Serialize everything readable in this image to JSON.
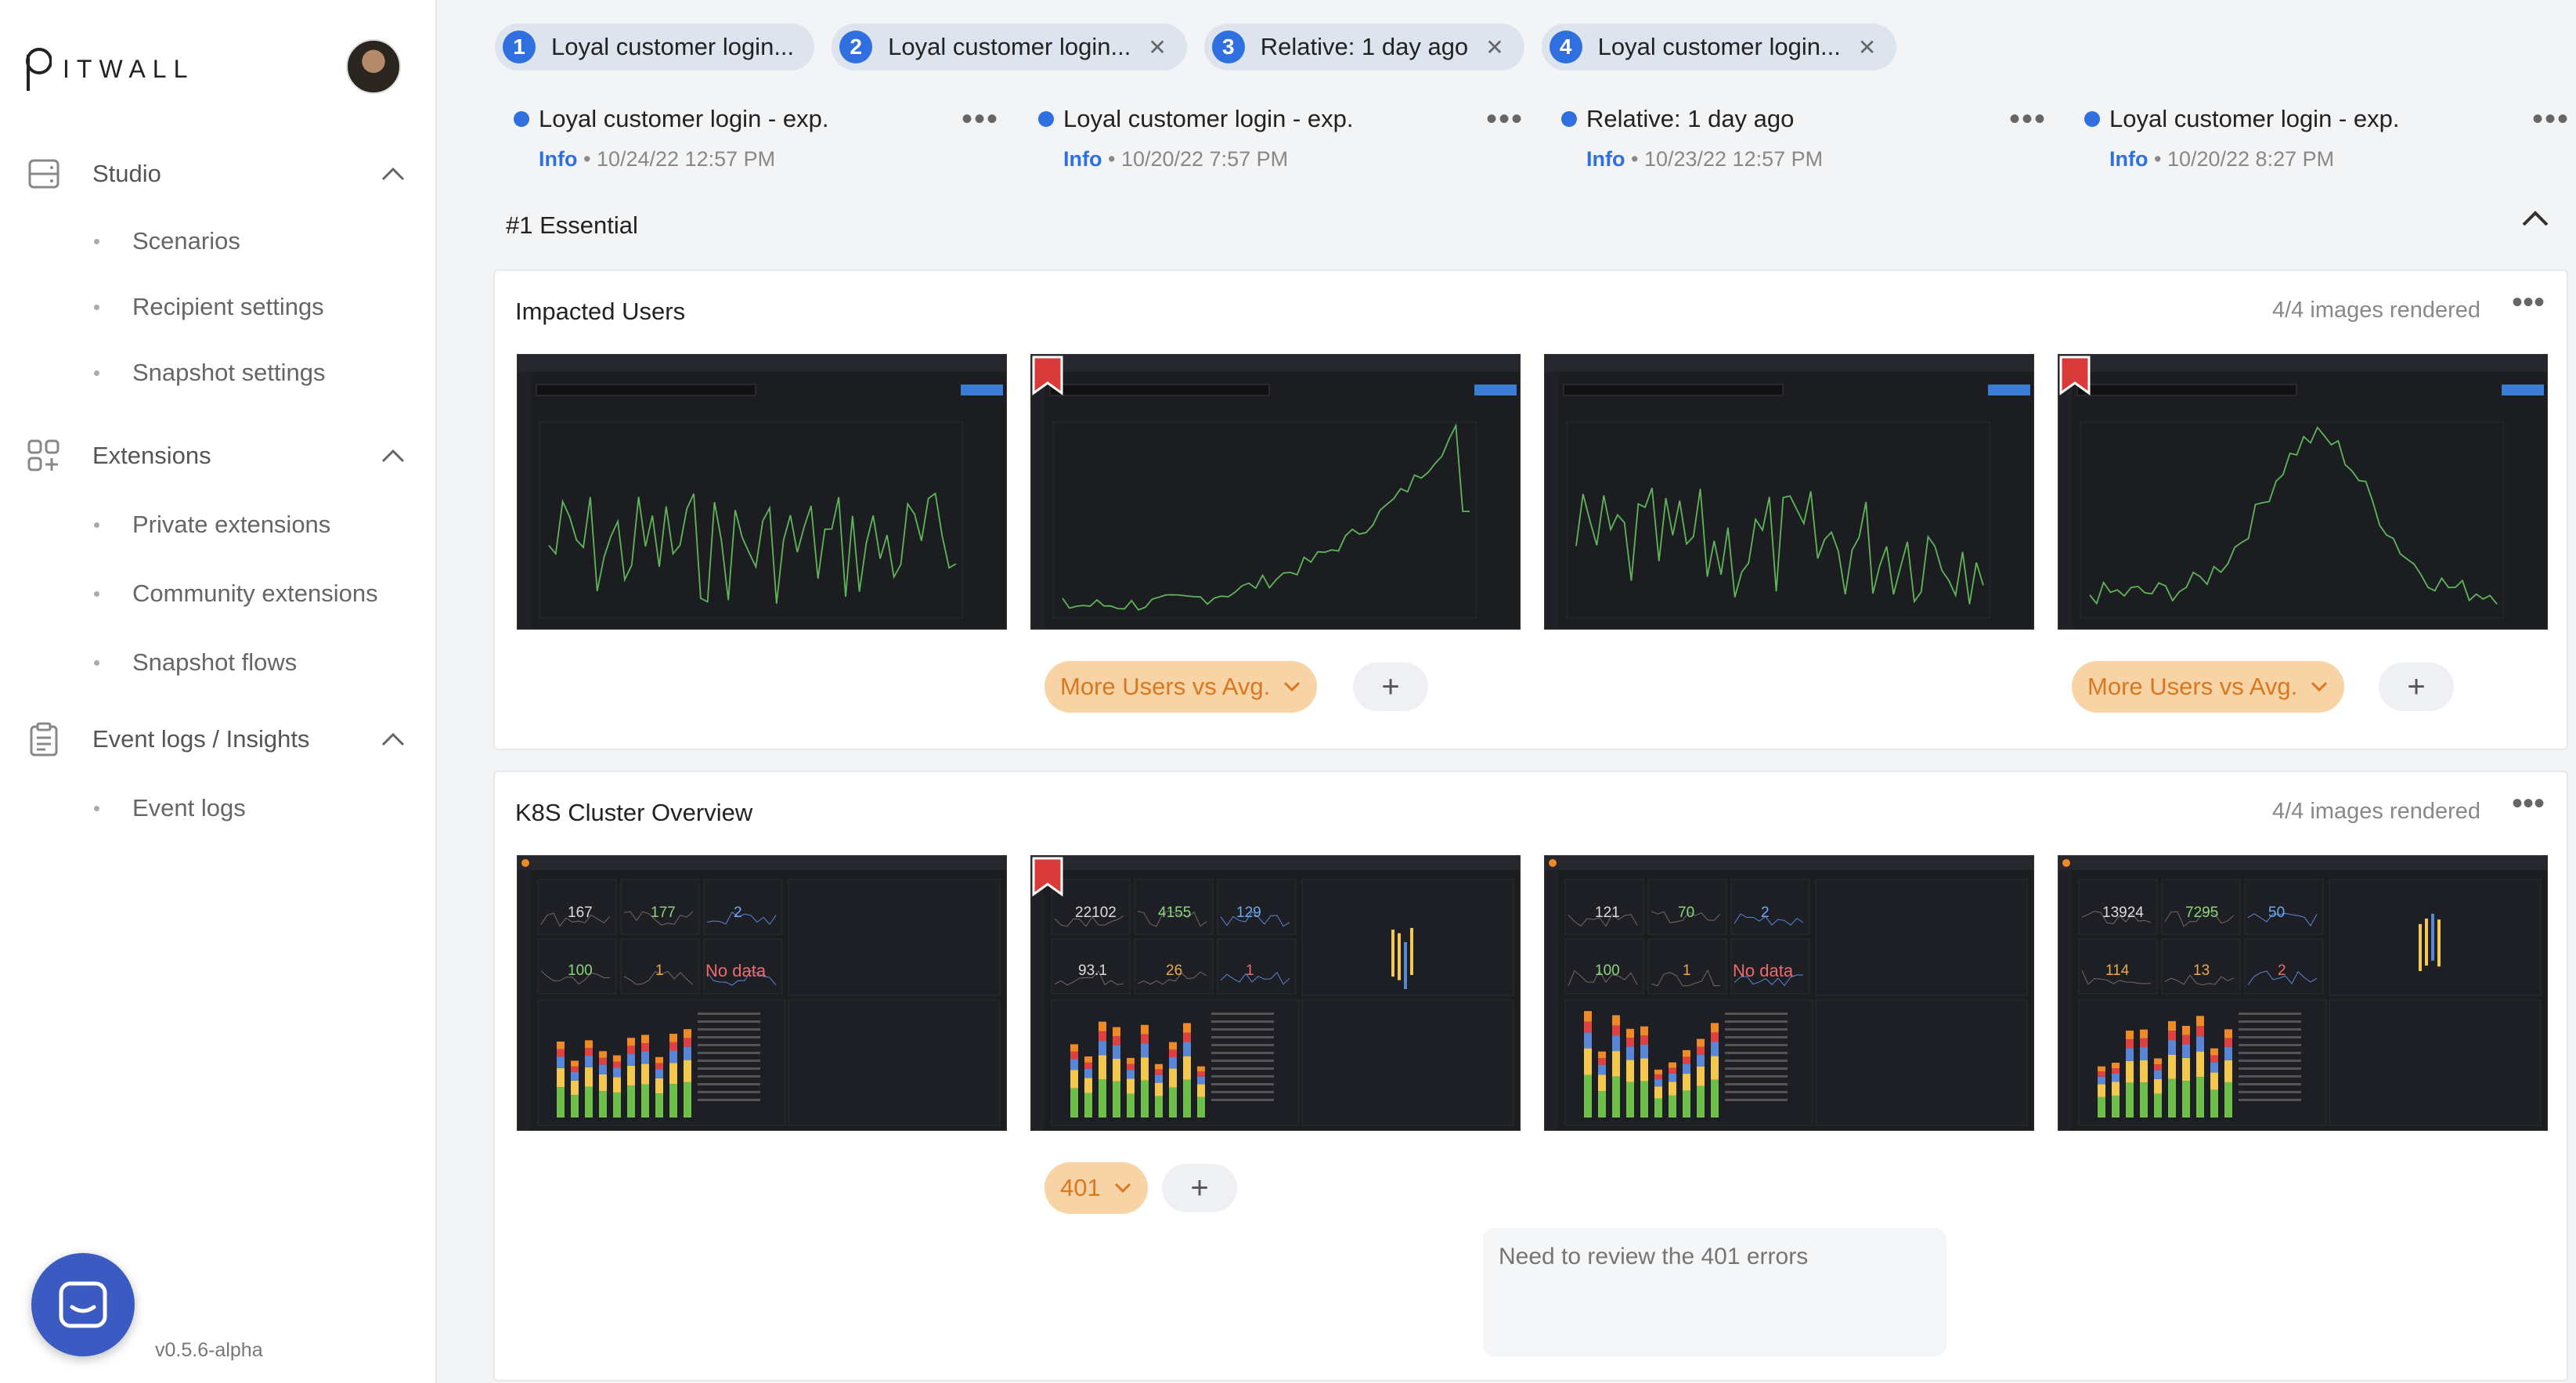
{
  "app": {
    "logo_text": "ITWALL",
    "version": "v0.5.6-alpha"
  },
  "sidebar": {
    "sections": [
      {
        "label": "Studio",
        "icon": "storage-icon",
        "items": [
          "Scenarios",
          "Recipient settings",
          "Snapshot settings"
        ]
      },
      {
        "label": "Extensions",
        "icon": "apps-add-icon",
        "items": [
          "Private extensions",
          "Community extensions",
          "Snapshot flows"
        ]
      },
      {
        "label": "Event logs / Insights",
        "icon": "clipboard-icon",
        "items": [
          "Event logs"
        ]
      }
    ]
  },
  "tabs": [
    {
      "num": "1",
      "label": "Loyal customer login...",
      "closable": false
    },
    {
      "num": "2",
      "label": "Loyal customer login...",
      "closable": true
    },
    {
      "num": "3",
      "label": "Relative: 1 day ago",
      "closable": true
    },
    {
      "num": "4",
      "label": "Loyal customer login...",
      "closable": true
    }
  ],
  "snapshots": [
    {
      "title": "Loyal customer login - exp.",
      "level": "Info",
      "timestamp": "10/24/22 12:57 PM"
    },
    {
      "title": "Loyal customer login - exp.",
      "level": "Info",
      "timestamp": "10/20/22 7:57 PM"
    },
    {
      "title": "Relative: 1 day ago",
      "level": "Info",
      "timestamp": "10/23/22 12:57 PM"
    },
    {
      "title": "Loyal customer login - exp.",
      "level": "Info",
      "timestamp": "10/20/22 8:27 PM"
    }
  ],
  "section": {
    "title": "#1 Essential"
  },
  "cards": [
    {
      "title": "Impacted Users",
      "status": "4/4 images rendered",
      "bookmarked": [
        false,
        true,
        false,
        true
      ],
      "tags": [
        {
          "label": "More Users vs Avg.",
          "column": 1
        },
        {
          "label": "More Users vs Avg.",
          "column": 3
        }
      ]
    },
    {
      "title": "K8S Cluster Overview",
      "status": "4/4 images rendered",
      "bookmarked": [
        false,
        true,
        false,
        false
      ],
      "stats": [
        [
          "167",
          "177",
          "2",
          "100",
          "1",
          "No data"
        ],
        [
          "22102",
          "4155",
          "129",
          "93.1",
          "26",
          "1"
        ],
        [
          "121",
          "70",
          "2",
          "100",
          "1",
          "No data"
        ],
        [
          "13924",
          "7295",
          "50",
          "114",
          "13",
          "2"
        ]
      ],
      "tags": [
        {
          "label": "401",
          "column": 1
        }
      ],
      "note_placeholder": "Need to review the 401 errors"
    }
  ],
  "colors": {
    "accent": "#2f6fe0",
    "tag_bg": "#f8d3a6",
    "tag_text": "#d9781f",
    "bookmark": "#d93a3a"
  }
}
